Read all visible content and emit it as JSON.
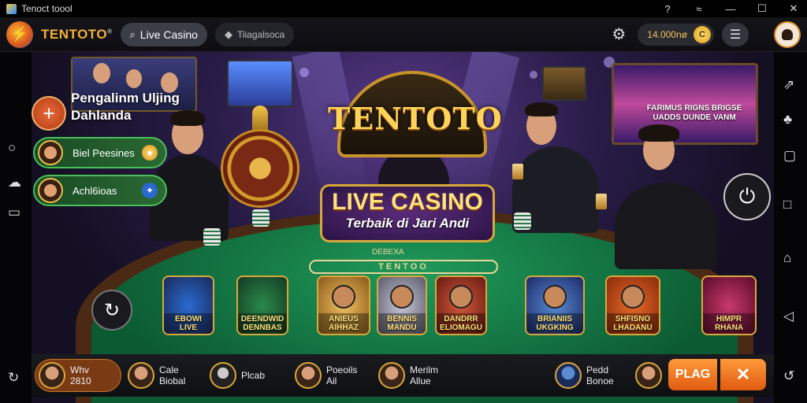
{
  "titlebar": {
    "title": "Tenoct toool",
    "icons": [
      "help-icon",
      "wifi-icon",
      "minimize-icon",
      "maximize-icon",
      "close-icon"
    ],
    "glyphs": [
      "?",
      "≈",
      "—",
      "☐",
      "✕"
    ]
  },
  "topnav": {
    "brand": "TENTOTO",
    "brand_mark": "®",
    "tabs": [
      {
        "label": "Live Casino",
        "icon": "search-icon",
        "active": true
      },
      {
        "label": "Tiiagalsoca",
        "icon": "tag-icon",
        "active": false
      }
    ],
    "balance": "14.000nø",
    "coin_symbol": "C",
    "menu_icon": "hamburger-icon"
  },
  "scene": {
    "logo": "TENTOTO",
    "live_title": "LIVE CASINO",
    "live_subtitle": "Terbaik di Jari Andi",
    "felt_top_label": "DEBEXA",
    "felt_label": "TENTOO",
    "tv_right_text": "FARIMUS RIGNS BRIGSE UADDS DUNDE VANM"
  },
  "left_panel": {
    "promo": "Pengalinm Uljing Dahlanda",
    "items": [
      {
        "label": "Biel Peesines",
        "icon": "ball-icon"
      },
      {
        "label": "Achl6ioas",
        "icon": "gift-icon"
      }
    ]
  },
  "tiles": [
    {
      "name": "EBOWI LIVE"
    },
    {
      "name": "DEENDWID DENNBAS"
    },
    {
      "name": "ANIEUS AIHHAZ"
    },
    {
      "name": "BENNIS MANDU"
    },
    {
      "name": "DANDRR ELIOMAGU"
    },
    {
      "name": "BRIANIIS UKGKING"
    },
    {
      "name": "SHFISNO LHADANU"
    },
    {
      "name": "HIMPR RHANA"
    }
  ],
  "bottom": {
    "players": [
      {
        "line1": "Whv",
        "line2": "2810"
      },
      {
        "line1": "Cale",
        "line2": "Biobal"
      },
      {
        "line1": "Plcab",
        "line2": ""
      },
      {
        "line1": "Poeoils",
        "line2": "Ail"
      },
      {
        "line1": "Merilm",
        "line2": "Allue"
      },
      {
        "line1": "Pedd",
        "line2": "Bonoe"
      }
    ],
    "play_label": "PLAG",
    "x_label": "✕"
  },
  "colors": {
    "accent": "#f3b03c",
    "play": "#f07a24",
    "pill_green": "#4ac05a",
    "gold": "#d9a83a"
  }
}
